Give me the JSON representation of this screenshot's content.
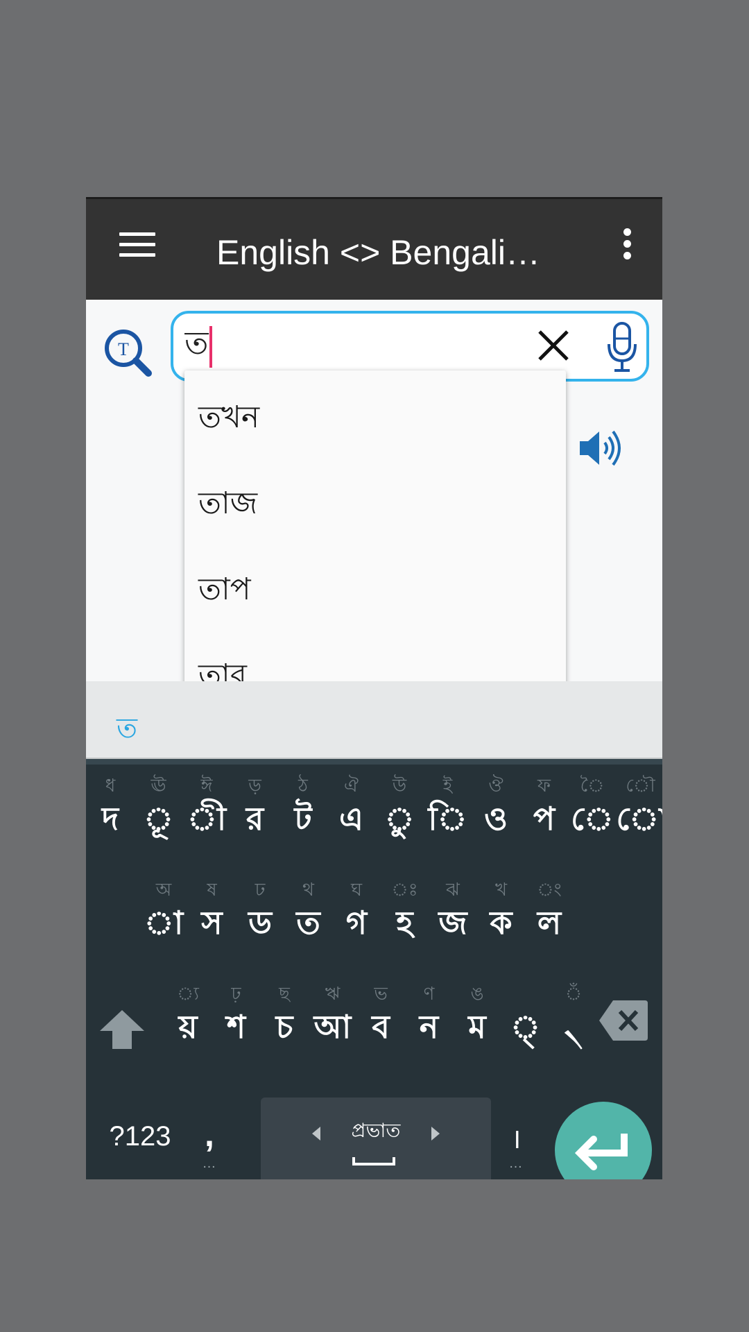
{
  "app_bar": {
    "title": "English <> Bengali…",
    "menu_icon": "hamburger-menu-icon",
    "overflow_icon": "more-vertical-icon"
  },
  "search": {
    "lookup_icon": "text-search-icon",
    "value": "ত",
    "placeholder": "",
    "clear_icon": "close-icon",
    "mic_icon": "microphone-icon",
    "border_color": "#34b3ec",
    "caret_color": "#e8306a"
  },
  "speaker_icon": "volume-up-icon",
  "suggestions": [
    "তখন",
    "তাজ",
    "তাপ",
    "তার"
  ],
  "composing": {
    "text": "ত",
    "color": "#2ba6e1"
  },
  "keyboard": {
    "row1": [
      {
        "main": "দ",
        "hint": "ধ"
      },
      {
        "main": "ূ",
        "hint": "ঊ"
      },
      {
        "main": "ী",
        "hint": "ঈ"
      },
      {
        "main": "র",
        "hint": "ড়"
      },
      {
        "main": "ট",
        "hint": "ঠ"
      },
      {
        "main": "এ",
        "hint": "ঐ"
      },
      {
        "main": "ু",
        "hint": "উ"
      },
      {
        "main": "ি",
        "hint": "ই"
      },
      {
        "main": "ও",
        "hint": "ঔ"
      },
      {
        "main": "প",
        "hint": "ফ"
      },
      {
        "main": "ে",
        "hint": "ৈ"
      },
      {
        "main": "ো",
        "hint": "ৌ"
      }
    ],
    "row2": [
      {
        "main": "া",
        "hint": "অ"
      },
      {
        "main": "স",
        "hint": "ষ"
      },
      {
        "main": "ড",
        "hint": "ঢ"
      },
      {
        "main": "ত",
        "hint": "থ"
      },
      {
        "main": "গ",
        "hint": "ঘ"
      },
      {
        "main": "হ",
        "hint": "ঃ"
      },
      {
        "main": "জ",
        "hint": "ঝ"
      },
      {
        "main": "ক",
        "hint": "খ"
      },
      {
        "main": "ল",
        "hint": "ং"
      }
    ],
    "row3": [
      {
        "main": "য়",
        "hint": "্য"
      },
      {
        "main": "শ",
        "hint": "ঢ়"
      },
      {
        "main": "চ",
        "hint": "ছ"
      },
      {
        "main": "আ",
        "hint": "ঋ"
      },
      {
        "main": "ব",
        "hint": "ভ"
      },
      {
        "main": "ন",
        "hint": "ণ"
      },
      {
        "main": "ম",
        "hint": "ঙ"
      },
      {
        "main": "্",
        "hint": ""
      },
      {
        "main": "৲",
        "hint": "ঁ"
      }
    ],
    "shift_icon": "shift-arrow-icon",
    "delete_icon": "backspace-icon",
    "symbols_label": "?123",
    "comma_label": ",",
    "comma_more": "…",
    "space_label": "প্রভাত",
    "lang_prev_icon": "triangle-left-icon",
    "lang_next_icon": "triangle-right-icon",
    "danda_label": "।",
    "danda_more": "…",
    "enter_icon": "enter-arrow-icon",
    "enter_color": "#52b5a9"
  }
}
